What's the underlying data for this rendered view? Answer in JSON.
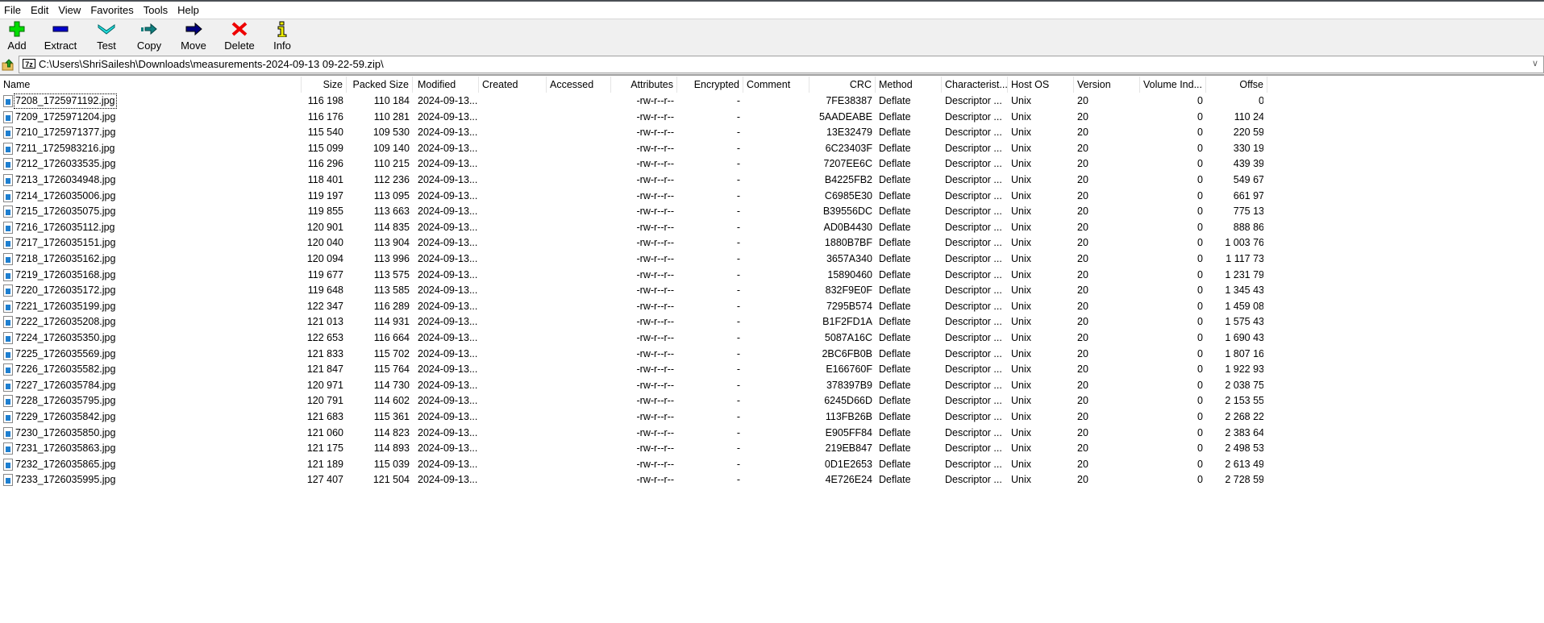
{
  "menu": [
    "File",
    "Edit",
    "View",
    "Favorites",
    "Tools",
    "Help"
  ],
  "toolbar": [
    {
      "label": "Add",
      "icon": "plus-icon",
      "color": "#00dd00"
    },
    {
      "label": "Extract",
      "icon": "minus-icon",
      "color": "#0000cc"
    },
    {
      "label": "Test",
      "icon": "check-chevron-icon",
      "color": "#22dddd"
    },
    {
      "label": "Copy",
      "icon": "copy-arrow-icon",
      "color": "#118080"
    },
    {
      "label": "Move",
      "icon": "move-arrow-icon",
      "color": "#000080"
    },
    {
      "label": "Delete",
      "icon": "x-icon",
      "color": "#ee0000"
    },
    {
      "label": "Info",
      "icon": "info-icon",
      "color": "#eeee00"
    }
  ],
  "address": {
    "path": "C:\\Users\\ShriSailesh\\Downloads\\measurements-2024-09-13 09-22-59.zip\\",
    "archive_icon_text": "7z"
  },
  "columns": [
    "Name",
    "Size",
    "Packed Size",
    "Modified",
    "Created",
    "Accessed",
    "Attributes",
    "Encrypted",
    "Comment",
    "CRC",
    "Method",
    "Characteristics",
    "Host OS",
    "Version",
    "Volume Ind...",
    "Offset"
  ],
  "column_headers_visible": {
    "characteristics": "Characterist...",
    "offset": "Offse"
  },
  "files": [
    [
      "7208_1725971192.jpg",
      "116 198",
      "110 184",
      "7FE38387",
      "0"
    ],
    [
      "7209_1725971204.jpg",
      "116 176",
      "110 281",
      "5AADEABE",
      "110 24"
    ],
    [
      "7210_1725971377.jpg",
      "115 540",
      "109 530",
      "13E32479",
      "220 59"
    ],
    [
      "7211_1725983216.jpg",
      "115 099",
      "109 140",
      "6C23403F",
      "330 19"
    ],
    [
      "7212_1726033535.jpg",
      "116 296",
      "110 215",
      "7207EE6C",
      "439 39"
    ],
    [
      "7213_1726034948.jpg",
      "118 401",
      "112 236",
      "B4225FB2",
      "549 67"
    ],
    [
      "7214_1726035006.jpg",
      "119 197",
      "113 095",
      "C6985E30",
      "661 97"
    ],
    [
      "7215_1726035075.jpg",
      "119 855",
      "113 663",
      "B39556DC",
      "775 13"
    ],
    [
      "7216_1726035112.jpg",
      "120 901",
      "114 835",
      "AD0B4430",
      "888 86"
    ],
    [
      "7217_1726035151.jpg",
      "120 040",
      "113 904",
      "1880B7BF",
      "1 003 76"
    ],
    [
      "7218_1726035162.jpg",
      "120 094",
      "113 996",
      "3657A340",
      "1 117 73"
    ],
    [
      "7219_1726035168.jpg",
      "119 677",
      "113 575",
      "15890460",
      "1 231 79"
    ],
    [
      "7220_1726035172.jpg",
      "119 648",
      "113 585",
      "832F9E0F",
      "1 345 43"
    ],
    [
      "7221_1726035199.jpg",
      "122 347",
      "116 289",
      "7295B574",
      "1 459 08"
    ],
    [
      "7222_1726035208.jpg",
      "121 013",
      "114 931",
      "B1F2FD1A",
      "1 575 43"
    ],
    [
      "7224_1726035350.jpg",
      "122 653",
      "116 664",
      "5087A16C",
      "1 690 43"
    ],
    [
      "7225_1726035569.jpg",
      "121 833",
      "115 702",
      "2BC6FB0B",
      "1 807 16"
    ],
    [
      "7226_1726035582.jpg",
      "121 847",
      "115 764",
      "E166760F",
      "1 922 93"
    ],
    [
      "7227_1726035784.jpg",
      "120 971",
      "114 730",
      "378397B9",
      "2 038 75"
    ],
    [
      "7228_1726035795.jpg",
      "120 791",
      "114 602",
      "6245D66D",
      "2 153 55"
    ],
    [
      "7229_1726035842.jpg",
      "121 683",
      "115 361",
      "113FB26B",
      "2 268 22"
    ],
    [
      "7230_1726035850.jpg",
      "121 060",
      "114 823",
      "E905FF84",
      "2 383 64"
    ],
    [
      "7231_1726035863.jpg",
      "121 175",
      "114 893",
      "219EB847",
      "2 498 53"
    ],
    [
      "7232_1726035865.jpg",
      "121 189",
      "115 039",
      "0D1E2653",
      "2 613 49"
    ],
    [
      "7233_1726035995.jpg",
      "127 407",
      "121 504",
      "4E726E24",
      "2 728 59"
    ]
  ],
  "common": {
    "modified": "2024-09-13...",
    "attributes": "-rw-r--r--",
    "encrypted": "-",
    "method": "Deflate",
    "characteristics": "Descriptor ...",
    "host_os": "Unix",
    "version": "20",
    "volume_index": "0"
  }
}
